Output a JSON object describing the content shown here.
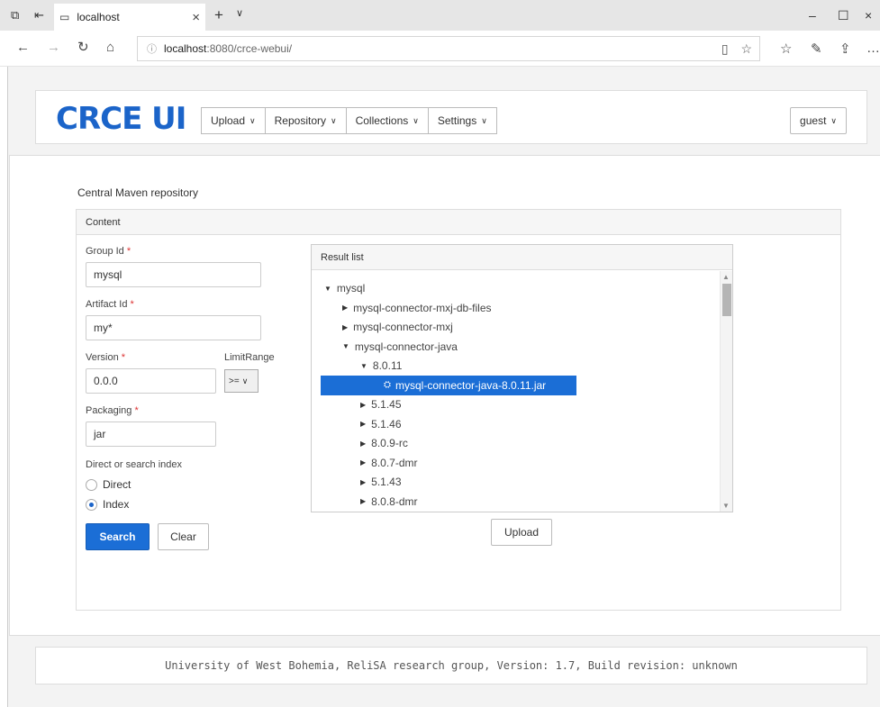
{
  "browser": {
    "tab_title": "localhost",
    "url_host": "localhost",
    "url_path": ":8080/crce-webui/",
    "icons": [
      "tab-actions-icon",
      "set-aside-icon",
      "page-icon",
      "close-icon",
      "new-tab-icon",
      "chevron-down-icon",
      "minimize-icon",
      "maximize-icon",
      "close-window-icon",
      "back-icon",
      "forward-icon",
      "refresh-icon",
      "home-icon",
      "info-icon",
      "reading-view-icon",
      "favorite-icon",
      "favorites-icon",
      "notes-icon",
      "share-icon",
      "more-icon"
    ]
  },
  "header": {
    "logo": "CRCE UI",
    "menu": [
      "Upload",
      "Repository",
      "Collections",
      "Settings"
    ],
    "user": "guest"
  },
  "main": {
    "repository_title": "Central Maven repository",
    "panel_title": "Content",
    "form": {
      "group_id_label": "Group Id",
      "group_id_value": "mysql",
      "artifact_id_label": "Artifact Id",
      "artifact_id_value": "my*",
      "version_label": "Version",
      "version_value": "0.0.0",
      "limit_range_label": "LimitRange",
      "limit_range_value": ">=",
      "packaging_label": "Packaging",
      "packaging_value": "jar",
      "mode_label": "Direct or search index",
      "mode_options": [
        "Direct",
        "Index"
      ],
      "mode_selected": "Index",
      "required_mark": "*",
      "search_button": "Search",
      "clear_button": "Clear"
    },
    "result": {
      "title": "Result list",
      "tree": [
        {
          "label": "mysql",
          "level": 0,
          "expanded": true
        },
        {
          "label": "mysql-connector-mxj-db-files",
          "level": 1,
          "expanded": false
        },
        {
          "label": "mysql-connector-mxj",
          "level": 1,
          "expanded": false
        },
        {
          "label": "mysql-connector-java",
          "level": 1,
          "expanded": true
        },
        {
          "label": "8.0.11",
          "level": 2,
          "expanded": true
        },
        {
          "label": "mysql-connector-java-8.0.11.jar",
          "level": 3,
          "selected": true
        },
        {
          "label": "5.1.45",
          "level": 2,
          "expanded": false
        },
        {
          "label": "5.1.46",
          "level": 2,
          "expanded": false
        },
        {
          "label": "8.0.9-rc",
          "level": 2,
          "expanded": false
        },
        {
          "label": "8.0.7-dmr",
          "level": 2,
          "expanded": false
        },
        {
          "label": "5.1.43",
          "level": 2,
          "expanded": false
        },
        {
          "label": "8.0.8-dmr",
          "level": 2,
          "expanded": false
        }
      ],
      "upload_button": "Upload"
    }
  },
  "footer": {
    "text": "University of West Bohemia, ReliSA research group, Version: 1.7, Build revision: unknown"
  }
}
